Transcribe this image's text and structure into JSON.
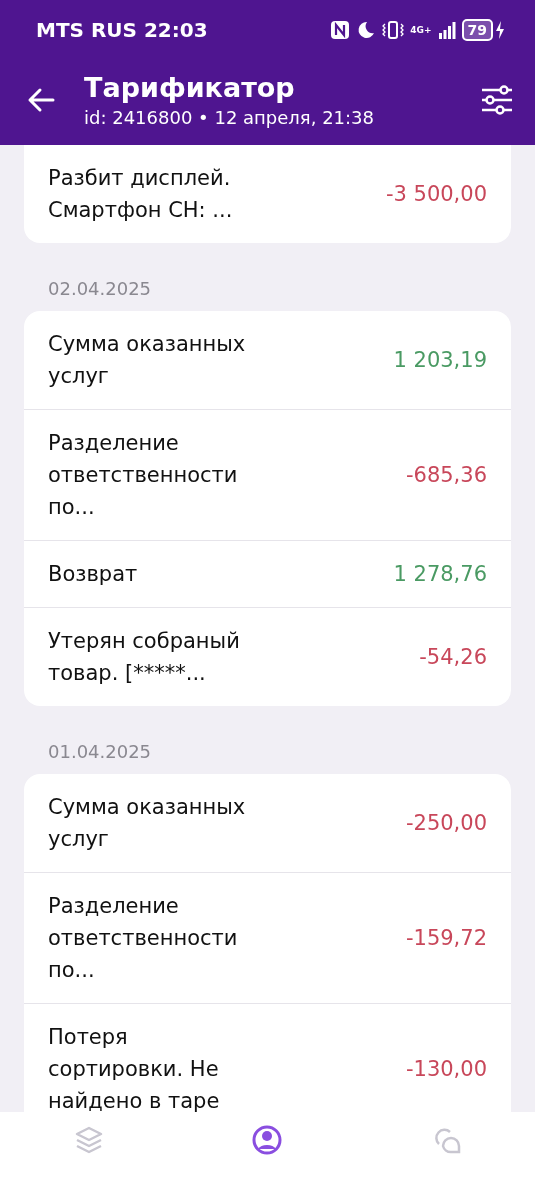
{
  "status_bar": {
    "carrier_time": "MTS RUS 22:03",
    "network": "4G+",
    "battery": "79"
  },
  "header": {
    "title": "Тарификатор",
    "subtitle": "id: 2416800 • 12 апреля, 21:38"
  },
  "groups": [
    {
      "items": [
        {
          "title": "Разбит дисплей.\nСмартфон СН: ...",
          "amount": "-3 500,00",
          "kind": "debit"
        }
      ]
    },
    {
      "date": "02.04.2025",
      "items": [
        {
          "title": "Сумма оказанных\nуслуг",
          "amount": "1 203,19",
          "kind": "credit"
        },
        {
          "title": "Разделение\nответственности\nпо...",
          "amount": "-685,36",
          "kind": "debit"
        },
        {
          "title": "Возврат",
          "amount": "1 278,76",
          "kind": "credit"
        },
        {
          "title": "Утерян собраный\nтовар. [*****...",
          "amount": "-54,26",
          "kind": "debit"
        }
      ]
    },
    {
      "date": "01.04.2025",
      "items": [
        {
          "title": "Сумма оказанных\nуслуг",
          "amount": "-250,00",
          "kind": "debit"
        },
        {
          "title": "Разделение\nответственности\nпо...",
          "amount": "-159,72",
          "kind": "debit"
        },
        {
          "title": "Потеря\nсортировки. Не\nнайдено в таре",
          "amount": "-130,00",
          "kind": "debit"
        }
      ]
    }
  ],
  "bottom_nav": [
    {
      "kind": "layers",
      "selected": false
    },
    {
      "kind": "profile",
      "selected": true
    },
    {
      "kind": "chat",
      "selected": false
    }
  ]
}
